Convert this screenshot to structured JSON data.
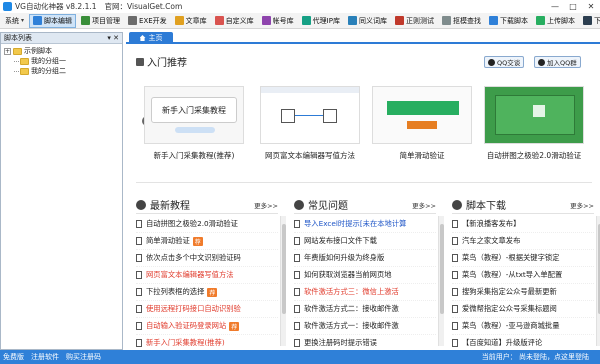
{
  "window": {
    "title": "VG自动化神器 v8.2.1.1",
    "site": "官网：VisualGet.Com",
    "controls": [
      "—",
      "□",
      "✕"
    ]
  },
  "toolbar": {
    "items": [
      {
        "label": "系统",
        "caret": "▾",
        "color": "#888888"
      },
      {
        "label": "脚本编辑",
        "color": "#2f80d8",
        "active": true
      },
      {
        "label": "项目管理",
        "color": "#3a8f3a"
      },
      {
        "label": "EXE开发",
        "color": "#6b6b6b"
      },
      {
        "label": "文章库",
        "color": "#e0a020"
      },
      {
        "label": "自定义库",
        "color": "#d9534f"
      },
      {
        "label": "帐号库",
        "color": "#8e44ad"
      },
      {
        "label": "代理IP库",
        "color": "#16a085"
      },
      {
        "label": "同义词库",
        "color": "#2980b9"
      },
      {
        "label": "正则测试",
        "color": "#c0392b"
      },
      {
        "label": "抠模查找",
        "color": "#7f8c8d"
      },
      {
        "label": "下载脚本",
        "color": "#2f80d8"
      },
      {
        "label": "上传脚本",
        "color": "#27ae60"
      },
      {
        "label": "下载管理",
        "color": "#2c3e50"
      }
    ]
  },
  "left_panel": {
    "header": "脚本列表",
    "pin": "▾ ✕",
    "tree": [
      {
        "label": "示例脚本",
        "exp": "+",
        "child": false
      },
      {
        "label": "我的分组一",
        "child": true
      },
      {
        "label": "我的分组二",
        "child": true
      }
    ]
  },
  "tabs": {
    "home": "主页"
  },
  "intro": {
    "title": "入门推荐",
    "qq_chat": "QQ交谈",
    "qq_group": "加入QQ群",
    "slides": [
      {
        "caption": "新手入门采集教程(推荐)",
        "thumb_text": "新手入门采集教程"
      },
      {
        "caption": "网页富文本编辑器写值方法",
        "thumb_text": ""
      },
      {
        "caption": "简单滑动验证",
        "thumb_text": ""
      },
      {
        "caption": "自动拼图之极验2.0滑动验证",
        "thumb_text": ""
      }
    ],
    "prev": "‹",
    "next": "›"
  },
  "columns": [
    {
      "title": "最新教程",
      "more": "更多>>",
      "icon_color": "#444444",
      "items": [
        {
          "text": "自动拼图之极验2.0滑动验证",
          "style": ""
        },
        {
          "text": "简单滑动验证",
          "style": "",
          "badge": "荐"
        },
        {
          "text": "依次点击多个中文识别验证码",
          "style": ""
        },
        {
          "text": "网页富文本编辑器写值方法",
          "style": "red"
        },
        {
          "text": "下拉列表框的选择",
          "style": "",
          "badge": "荐"
        },
        {
          "text": "使用远程打码接口自动识别验",
          "style": "red"
        },
        {
          "text": "自动输入验证码登录网站",
          "style": "red",
          "badge": "荐"
        },
        {
          "text": "新手入门采集教程(推荐)",
          "style": "red"
        }
      ]
    },
    {
      "title": "常见问题",
      "more": "更多>>",
      "icon_color": "#444444",
      "items": [
        {
          "text": "导入Excel时提示[未在本地计算",
          "style": "blue"
        },
        {
          "text": "网站发布接口文件下载",
          "style": ""
        },
        {
          "text": "年费版如何升级为终身版",
          "style": ""
        },
        {
          "text": "如何获取浏览器当前网页地",
          "style": ""
        },
        {
          "text": "软件激活方式三：微信上激活",
          "style": "red"
        },
        {
          "text": "软件激活方式二：接收邮件激",
          "style": ""
        },
        {
          "text": "软件激活方式一：接收邮件激",
          "style": ""
        },
        {
          "text": "更换注册码时提示错误",
          "style": ""
        }
      ]
    },
    {
      "title": "脚本下载",
      "more": "更多>>",
      "icon_color": "#444444",
      "items": [
        {
          "text": "【新浪播客发布】",
          "style": ""
        },
        {
          "text": "汽车之家文章发布",
          "style": ""
        },
        {
          "text": "菜鸟（教程）-根据关键字锁定",
          "style": ""
        },
        {
          "text": "菜鸟（教程）-从txt导入单配置",
          "style": ""
        },
        {
          "text": "搜狗采集指定公众号最新更新",
          "style": ""
        },
        {
          "text": "爱微帮指定公众号采集标题阅",
          "style": ""
        },
        {
          "text": "菜鸟（教程）-亚马逊商城批量",
          "style": ""
        },
        {
          "text": "【百度知道】升级版评论",
          "style": ""
        }
      ]
    }
  ],
  "statusbar": {
    "items": [
      "免费版",
      "注册软件",
      "购买注册码"
    ],
    "user": "当前用户： 尚未登陆，点这里登陆"
  }
}
